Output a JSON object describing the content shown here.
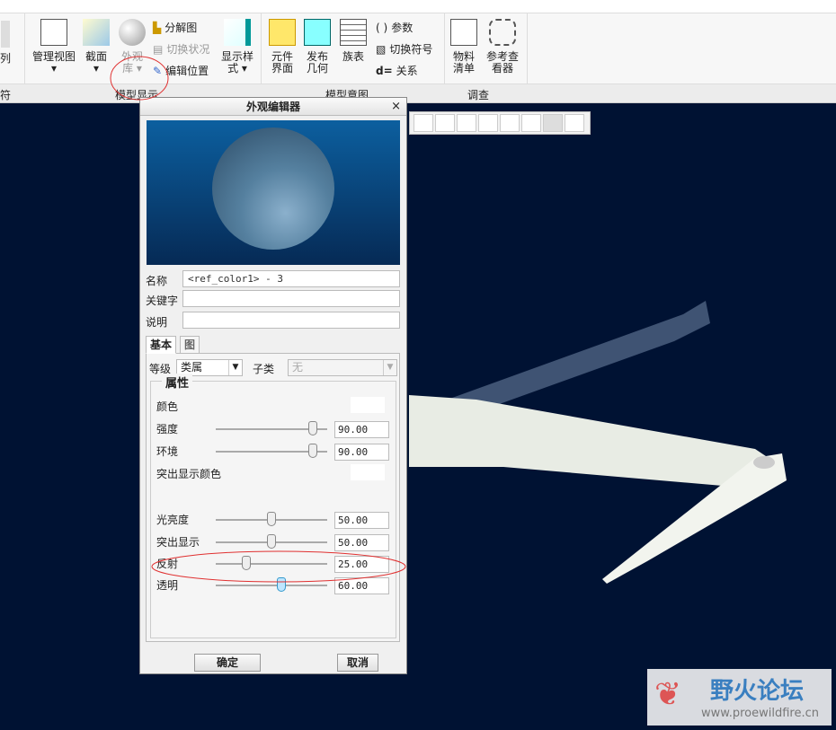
{
  "ribbon": {
    "left_partial": "列",
    "buttons": [
      {
        "label": "管理视图"
      },
      {
        "label": "截面"
      },
      {
        "label": "外观库"
      },
      {
        "label": "显示样式"
      },
      {
        "label": "元件界面"
      },
      {
        "label": "发布几何"
      },
      {
        "label": "族表"
      },
      {
        "label": "物料清单"
      },
      {
        "label": "参考查看器"
      }
    ],
    "small": {
      "explode": "分解图",
      "toggle_state": "切换状况",
      "edit_position": "编辑位置",
      "params": "参数",
      "switch_symbol": "切换符号",
      "relations": "关系"
    },
    "groups": {
      "left_partial": "符",
      "model_display": "模型显示",
      "model_intent": "模型意图",
      "investigate": "调查"
    }
  },
  "dialog": {
    "title": "外观编辑器",
    "close": "×",
    "name_label": "名称",
    "name_value": "<ref_color1> - 3",
    "keyword_label": "关键字",
    "keyword_value": "",
    "desc_label": "说明",
    "desc_value": "",
    "tabs": [
      "基本",
      "图"
    ],
    "class_label": "等级",
    "class_value": "类属",
    "subclass_label": "子类",
    "subclass_value": "无",
    "group_title": "属性",
    "color_label": "颜色",
    "highlight_color_label": "突出显示颜色",
    "sliders": [
      {
        "label": "强度",
        "value": "90.00",
        "pct": 90
      },
      {
        "label": "环境",
        "value": "90.00",
        "pct": 90
      },
      {
        "label": "光亮度",
        "value": "50.00",
        "pct": 50
      },
      {
        "label": "突出显示",
        "value": "50.00",
        "pct": 50
      },
      {
        "label": "反射",
        "value": "25.00",
        "pct": 25
      },
      {
        "label": "透明",
        "value": "60.00",
        "pct": 60
      }
    ],
    "ok": "确定",
    "cancel": "取消"
  },
  "watermark": {
    "name": "野火论坛",
    "url": "www.proewildfire.cn"
  },
  "colors": {
    "canvas": "#001233",
    "annotation": "#e03030"
  }
}
